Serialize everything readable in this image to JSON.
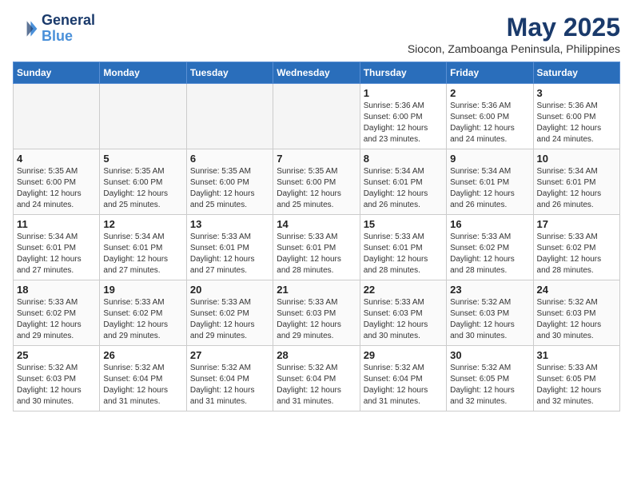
{
  "header": {
    "logo_line1": "General",
    "logo_line2": "Blue",
    "title": "May 2025",
    "subtitle": "Siocon, Zamboanga Peninsula, Philippines"
  },
  "weekdays": [
    "Sunday",
    "Monday",
    "Tuesday",
    "Wednesday",
    "Thursday",
    "Friday",
    "Saturday"
  ],
  "weeks": [
    [
      {
        "day": "",
        "info": ""
      },
      {
        "day": "",
        "info": ""
      },
      {
        "day": "",
        "info": ""
      },
      {
        "day": "",
        "info": ""
      },
      {
        "day": "1",
        "info": "Sunrise: 5:36 AM\nSunset: 6:00 PM\nDaylight: 12 hours\nand 23 minutes."
      },
      {
        "day": "2",
        "info": "Sunrise: 5:36 AM\nSunset: 6:00 PM\nDaylight: 12 hours\nand 24 minutes."
      },
      {
        "day": "3",
        "info": "Sunrise: 5:36 AM\nSunset: 6:00 PM\nDaylight: 12 hours\nand 24 minutes."
      }
    ],
    [
      {
        "day": "4",
        "info": "Sunrise: 5:35 AM\nSunset: 6:00 PM\nDaylight: 12 hours\nand 24 minutes."
      },
      {
        "day": "5",
        "info": "Sunrise: 5:35 AM\nSunset: 6:00 PM\nDaylight: 12 hours\nand 25 minutes."
      },
      {
        "day": "6",
        "info": "Sunrise: 5:35 AM\nSunset: 6:00 PM\nDaylight: 12 hours\nand 25 minutes."
      },
      {
        "day": "7",
        "info": "Sunrise: 5:35 AM\nSunset: 6:00 PM\nDaylight: 12 hours\nand 25 minutes."
      },
      {
        "day": "8",
        "info": "Sunrise: 5:34 AM\nSunset: 6:01 PM\nDaylight: 12 hours\nand 26 minutes."
      },
      {
        "day": "9",
        "info": "Sunrise: 5:34 AM\nSunset: 6:01 PM\nDaylight: 12 hours\nand 26 minutes."
      },
      {
        "day": "10",
        "info": "Sunrise: 5:34 AM\nSunset: 6:01 PM\nDaylight: 12 hours\nand 26 minutes."
      }
    ],
    [
      {
        "day": "11",
        "info": "Sunrise: 5:34 AM\nSunset: 6:01 PM\nDaylight: 12 hours\nand 27 minutes."
      },
      {
        "day": "12",
        "info": "Sunrise: 5:34 AM\nSunset: 6:01 PM\nDaylight: 12 hours\nand 27 minutes."
      },
      {
        "day": "13",
        "info": "Sunrise: 5:33 AM\nSunset: 6:01 PM\nDaylight: 12 hours\nand 27 minutes."
      },
      {
        "day": "14",
        "info": "Sunrise: 5:33 AM\nSunset: 6:01 PM\nDaylight: 12 hours\nand 28 minutes."
      },
      {
        "day": "15",
        "info": "Sunrise: 5:33 AM\nSunset: 6:01 PM\nDaylight: 12 hours\nand 28 minutes."
      },
      {
        "day": "16",
        "info": "Sunrise: 5:33 AM\nSunset: 6:02 PM\nDaylight: 12 hours\nand 28 minutes."
      },
      {
        "day": "17",
        "info": "Sunrise: 5:33 AM\nSunset: 6:02 PM\nDaylight: 12 hours\nand 28 minutes."
      }
    ],
    [
      {
        "day": "18",
        "info": "Sunrise: 5:33 AM\nSunset: 6:02 PM\nDaylight: 12 hours\nand 29 minutes."
      },
      {
        "day": "19",
        "info": "Sunrise: 5:33 AM\nSunset: 6:02 PM\nDaylight: 12 hours\nand 29 minutes."
      },
      {
        "day": "20",
        "info": "Sunrise: 5:33 AM\nSunset: 6:02 PM\nDaylight: 12 hours\nand 29 minutes."
      },
      {
        "day": "21",
        "info": "Sunrise: 5:33 AM\nSunset: 6:03 PM\nDaylight: 12 hours\nand 29 minutes."
      },
      {
        "day": "22",
        "info": "Sunrise: 5:33 AM\nSunset: 6:03 PM\nDaylight: 12 hours\nand 30 minutes."
      },
      {
        "day": "23",
        "info": "Sunrise: 5:32 AM\nSunset: 6:03 PM\nDaylight: 12 hours\nand 30 minutes."
      },
      {
        "day": "24",
        "info": "Sunrise: 5:32 AM\nSunset: 6:03 PM\nDaylight: 12 hours\nand 30 minutes."
      }
    ],
    [
      {
        "day": "25",
        "info": "Sunrise: 5:32 AM\nSunset: 6:03 PM\nDaylight: 12 hours\nand 30 minutes."
      },
      {
        "day": "26",
        "info": "Sunrise: 5:32 AM\nSunset: 6:04 PM\nDaylight: 12 hours\nand 31 minutes."
      },
      {
        "day": "27",
        "info": "Sunrise: 5:32 AM\nSunset: 6:04 PM\nDaylight: 12 hours\nand 31 minutes."
      },
      {
        "day": "28",
        "info": "Sunrise: 5:32 AM\nSunset: 6:04 PM\nDaylight: 12 hours\nand 31 minutes."
      },
      {
        "day": "29",
        "info": "Sunrise: 5:32 AM\nSunset: 6:04 PM\nDaylight: 12 hours\nand 31 minutes."
      },
      {
        "day": "30",
        "info": "Sunrise: 5:32 AM\nSunset: 6:05 PM\nDaylight: 12 hours\nand 32 minutes."
      },
      {
        "day": "31",
        "info": "Sunrise: 5:33 AM\nSunset: 6:05 PM\nDaylight: 12 hours\nand 32 minutes."
      }
    ]
  ]
}
